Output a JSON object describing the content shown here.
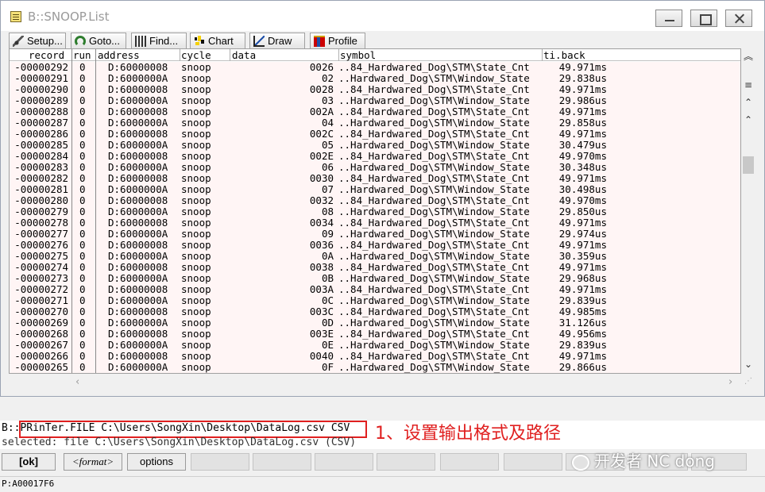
{
  "window": {
    "title": "B::SNOOP.List"
  },
  "toolbar": {
    "buttons": [
      {
        "label": "Setup...",
        "icon": "wrench-icon"
      },
      {
        "label": "Goto...",
        "icon": "goto-icon"
      },
      {
        "label": "Find...",
        "icon": "binoculars-icon"
      },
      {
        "label": "Chart",
        "icon": "chart-icon"
      },
      {
        "label": "Draw",
        "icon": "draw-icon"
      },
      {
        "label": "Profile",
        "icon": "profile-icon"
      }
    ]
  },
  "table": {
    "columns": [
      "record",
      "run",
      "address",
      "cycle",
      "data",
      "symbol",
      "ti.back"
    ],
    "rows": [
      [
        "-00000292",
        "0",
        "D:60000008",
        "snoop",
        "0026",
        "..84_Hardwared_Dog\\STM\\State_Cnt",
        "49.971ms"
      ],
      [
        "-00000291",
        "0",
        "D:6000000A",
        "snoop",
        "02",
        "..Hardwared_Dog\\STM\\Window_State",
        "29.838us"
      ],
      [
        "-00000290",
        "0",
        "D:60000008",
        "snoop",
        "0028",
        "..84_Hardwared_Dog\\STM\\State_Cnt",
        "49.971ms"
      ],
      [
        "-00000289",
        "0",
        "D:6000000A",
        "snoop",
        "03",
        "..Hardwared_Dog\\STM\\Window_State",
        "29.986us"
      ],
      [
        "-00000288",
        "0",
        "D:60000008",
        "snoop",
        "002A",
        "..84_Hardwared_Dog\\STM\\State_Cnt",
        "49.971ms"
      ],
      [
        "-00000287",
        "0",
        "D:6000000A",
        "snoop",
        "04",
        "..Hardwared_Dog\\STM\\Window_State",
        "29.858us"
      ],
      [
        "-00000286",
        "0",
        "D:60000008",
        "snoop",
        "002C",
        "..84_Hardwared_Dog\\STM\\State_Cnt",
        "49.971ms"
      ],
      [
        "-00000285",
        "0",
        "D:6000000A",
        "snoop",
        "05",
        "..Hardwared_Dog\\STM\\Window_State",
        "30.479us"
      ],
      [
        "-00000284",
        "0",
        "D:60000008",
        "snoop",
        "002E",
        "..84_Hardwared_Dog\\STM\\State_Cnt",
        "49.970ms"
      ],
      [
        "-00000283",
        "0",
        "D:6000000A",
        "snoop",
        "06",
        "..Hardwared_Dog\\STM\\Window_State",
        "30.348us"
      ],
      [
        "-00000282",
        "0",
        "D:60000008",
        "snoop",
        "0030",
        "..84_Hardwared_Dog\\STM\\State_Cnt",
        "49.971ms"
      ],
      [
        "-00000281",
        "0",
        "D:6000000A",
        "snoop",
        "07",
        "..Hardwared_Dog\\STM\\Window_State",
        "30.498us"
      ],
      [
        "-00000280",
        "0",
        "D:60000008",
        "snoop",
        "0032",
        "..84_Hardwared_Dog\\STM\\State_Cnt",
        "49.970ms"
      ],
      [
        "-00000279",
        "0",
        "D:6000000A",
        "snoop",
        "08",
        "..Hardwared_Dog\\STM\\Window_State",
        "29.850us"
      ],
      [
        "-00000278",
        "0",
        "D:60000008",
        "snoop",
        "0034",
        "..84_Hardwared_Dog\\STM\\State_Cnt",
        "49.971ms"
      ],
      [
        "-00000277",
        "0",
        "D:6000000A",
        "snoop",
        "09",
        "..Hardwared_Dog\\STM\\Window_State",
        "29.974us"
      ],
      [
        "-00000276",
        "0",
        "D:60000008",
        "snoop",
        "0036",
        "..84_Hardwared_Dog\\STM\\State_Cnt",
        "49.971ms"
      ],
      [
        "-00000275",
        "0",
        "D:6000000A",
        "snoop",
        "0A",
        "..Hardwared_Dog\\STM\\Window_State",
        "30.359us"
      ],
      [
        "-00000274",
        "0",
        "D:60000008",
        "snoop",
        "0038",
        "..84_Hardwared_Dog\\STM\\State_Cnt",
        "49.971ms"
      ],
      [
        "-00000273",
        "0",
        "D:6000000A",
        "snoop",
        "0B",
        "..Hardwared_Dog\\STM\\Window_State",
        "29.968us"
      ],
      [
        "-00000272",
        "0",
        "D:60000008",
        "snoop",
        "003A",
        "..84_Hardwared_Dog\\STM\\State_Cnt",
        "49.971ms"
      ],
      [
        "-00000271",
        "0",
        "D:6000000A",
        "snoop",
        "0C",
        "..Hardwared_Dog\\STM\\Window_State",
        "29.839us"
      ],
      [
        "-00000270",
        "0",
        "D:60000008",
        "snoop",
        "003C",
        "..84_Hardwared_Dog\\STM\\State_Cnt",
        "49.985ms"
      ],
      [
        "-00000269",
        "0",
        "D:6000000A",
        "snoop",
        "0D",
        "..Hardwared_Dog\\STM\\Window_State",
        "31.126us"
      ],
      [
        "-00000268",
        "0",
        "D:60000008",
        "snoop",
        "003E",
        "..84_Hardwared_Dog\\STM\\State_Cnt",
        "49.956ms"
      ],
      [
        "-00000267",
        "0",
        "D:6000000A",
        "snoop",
        "0E",
        "..Hardwared_Dog\\STM\\Window_State",
        "29.839us"
      ],
      [
        "-00000266",
        "0",
        "D:60000008",
        "snoop",
        "0040",
        "..84_Hardwared_Dog\\STM\\State_Cnt",
        "49.971ms"
      ],
      [
        "-00000265",
        "0",
        "D:6000000A",
        "snoop",
        "0F",
        "..Hardwared_Dog\\STM\\Window_State",
        "29.866us"
      ]
    ]
  },
  "command": {
    "prompt": "B::",
    "input": "PRinTer.FILE C:\\Users\\SongXin\\Desktop\\DataLog.csv CSV",
    "selected": "selected: file C:\\Users\\SongXin\\Desktop\\DataLog.csv (CSV)",
    "annotation": "1、设置输出格式及路径"
  },
  "softkeys": [
    "[ok]",
    "<format>",
    "options"
  ],
  "watermark": "开发者 NC dong",
  "status": {
    "address": "P:A00017F6"
  },
  "colors": {
    "row_background": "#fff5f5",
    "annotation": "#e02020"
  }
}
